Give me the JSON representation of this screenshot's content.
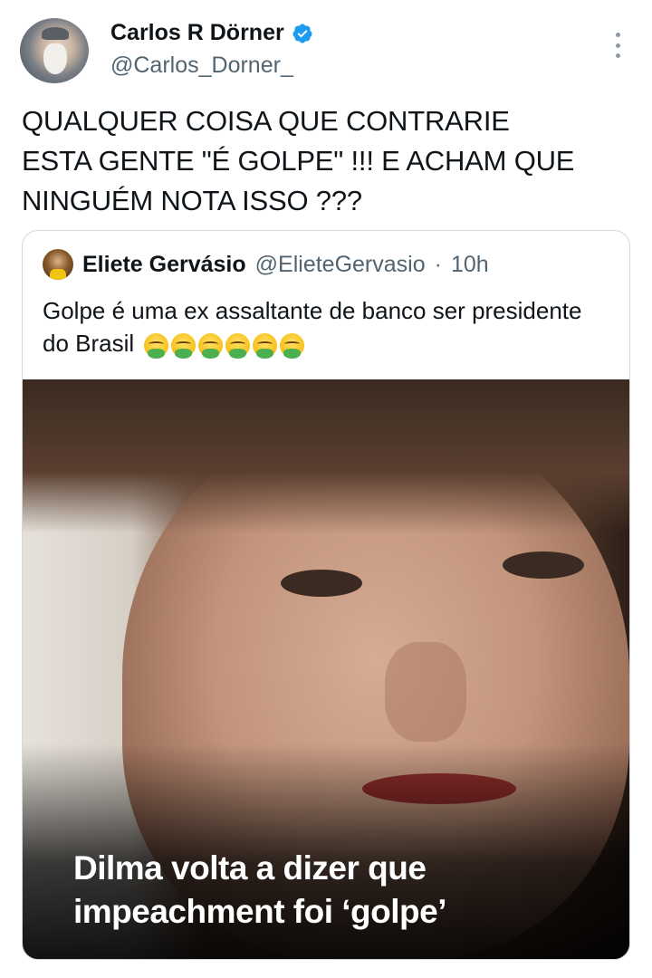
{
  "tweet": {
    "author": {
      "display_name": "Carlos R Dörner",
      "handle": "@Carlos_Dorner_",
      "verified": true
    },
    "text": "QUALQUER COISA QUE CONTRARIE\nESTA GENTE \"É GOLPE\" !!! E ACHAM QUE\nNINGUÉM NOTA ISSO ???",
    "menu_icon": "more-vertical-icon"
  },
  "quoted_tweet": {
    "author": {
      "display_name": "Eliete Gervásio",
      "handle": "@ElieteGervasio"
    },
    "separator": "·",
    "time": "10h",
    "text": "Golpe é uma ex assaltante de banco ser presidente do Brasil",
    "emoji": [
      "vomit-icon",
      "vomit-icon",
      "vomit-icon",
      "vomit-icon",
      "vomit-icon",
      "vomit-icon"
    ],
    "image_caption": "Dilma volta a dizer que\nimpeachment foi ‘golpe’"
  },
  "colors": {
    "text_primary": "#0f1419",
    "text_secondary": "#536471",
    "verified_blue": "#1d9bf0",
    "border": "#cfd9de"
  }
}
